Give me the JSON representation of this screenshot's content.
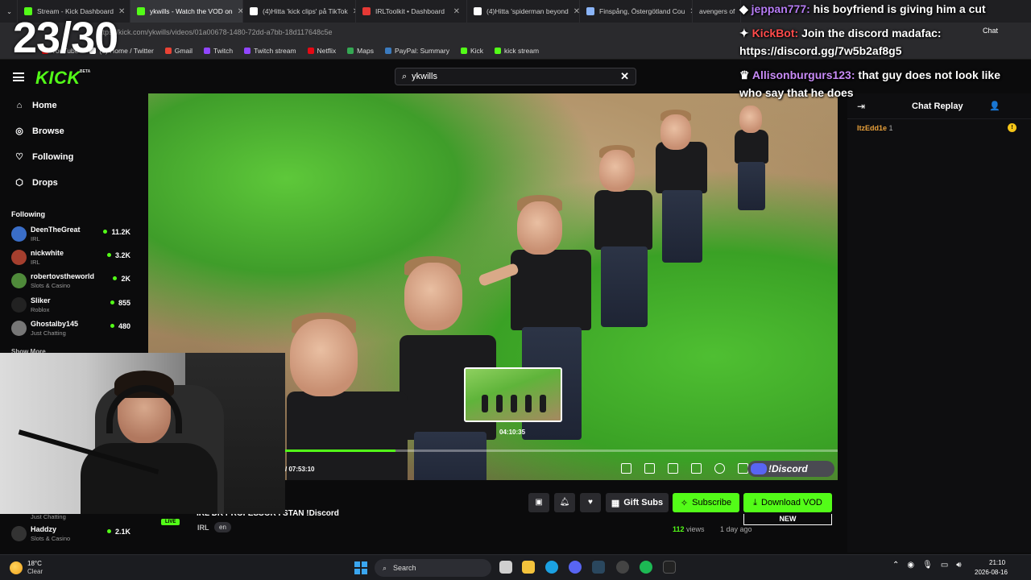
{
  "browser": {
    "tabs": [
      {
        "label": "Stream - Kick Dashboard",
        "color": "#53fc18"
      },
      {
        "label": "ykwills - Watch the VOD on",
        "color": "#53fc18"
      },
      {
        "label": "(4)Hitta 'kick clips' på TikTok",
        "color": "#ffffff"
      },
      {
        "label": "IRLToolkit • Dashboard",
        "color": "#e53935"
      },
      {
        "label": "(4)Hitta 'spiderman beyond",
        "color": "#ffffff"
      },
      {
        "label": "Finspång, Östergötland Cou",
        "color": "#8ab4f8"
      },
      {
        "label": "avengers of",
        "color": "#8ab4f8"
      }
    ],
    "url": "https://kick.com/ykwills/videos/01a00678-1480-72dd-a7bb-18d117648c5e",
    "bookmarks": [
      {
        "label": "YouTube",
        "color": "#ff0000"
      },
      {
        "label": "(9) Home / Twitter",
        "color": "#ffffff"
      },
      {
        "label": "Gmail",
        "color": "#ea4335"
      },
      {
        "label": "Twitch",
        "color": "#9146ff"
      },
      {
        "label": "Twitch stream",
        "color": "#9146ff"
      },
      {
        "label": "Netflix",
        "color": "#e50914"
      },
      {
        "label": "Maps",
        "color": "#34a853"
      },
      {
        "label": "PayPal: Summary",
        "color": "#003087"
      },
      {
        "label": "Kick",
        "color": "#53fc18"
      },
      {
        "label": "kick stream",
        "color": "#53fc18"
      }
    ]
  },
  "header": {
    "logo": "KICK",
    "logo_beta": "BETA",
    "search_value": "ykwills"
  },
  "sidebar": {
    "nav": [
      {
        "label": "Home",
        "icon": "home-icon"
      },
      {
        "label": "Browse",
        "icon": "compass-icon"
      },
      {
        "label": "Following",
        "icon": "heart-icon"
      },
      {
        "label": "Drops",
        "icon": "drop-icon"
      }
    ],
    "following_header": "Following",
    "channels": [
      {
        "name": "DeenTheGreat",
        "category": "IRL",
        "viewers": "11.2K",
        "color": "#3a6ec8"
      },
      {
        "name": "nickwhite",
        "category": "IRL",
        "viewers": "3.2K",
        "color": "#a53f2e"
      },
      {
        "name": "robertovstheworld",
        "category": "Slots & Casino",
        "viewers": "2K",
        "color": "#4f8a3a"
      },
      {
        "name": "Sliker",
        "category": "Roblox",
        "viewers": "855",
        "color": "#222222"
      },
      {
        "name": "Ghostalby145",
        "category": "Just Chatting",
        "viewers": "480",
        "color": "#777777"
      }
    ],
    "show_more": "Show More",
    "lower_category": "Just Chatting",
    "lower_channel": {
      "name": "Haddzy",
      "category": "Slots & Casino",
      "viewers": "2.1K"
    }
  },
  "overlay": {
    "counter": "23/30"
  },
  "player": {
    "preview_time": "04:10:35",
    "play_time": "/ 07:53:10",
    "progress_fraction": 0.2,
    "discord_badge": "!Discord"
  },
  "video_info": {
    "title": "IRL  DK PROFESSOR I STAN  !Discord",
    "live": "LIVE",
    "category": "IRL",
    "language": "en",
    "views_count": "112",
    "views_label": "views",
    "ago": "1 day ago",
    "gift_subs": "Gift Subs",
    "subscribe": "Subscribe",
    "download": "Download VOD",
    "new_badge": "NEW"
  },
  "chat": {
    "title": "Chat Replay",
    "user": "ItzEdd1e",
    "user_count": "1"
  },
  "stream_chat": [
    {
      "user": "jeppan777:",
      "text": " his boyfriend is giving him a cut"
    },
    {
      "user": "KickBot:",
      "text": " Join the discord madafac:"
    },
    {
      "user": "",
      "text": "https://discord.gg/7w5b2af8g5"
    },
    {
      "user": "Allisonburgurs123:",
      "text": " that guy does not look like"
    },
    {
      "user": "",
      "text": "who say that he does"
    }
  ],
  "taskbar": {
    "temperature": "18°C",
    "condition": "Clear",
    "search": "Search",
    "time": "21:10",
    "date": "2026-08-16",
    "chat_label": "Chat"
  }
}
